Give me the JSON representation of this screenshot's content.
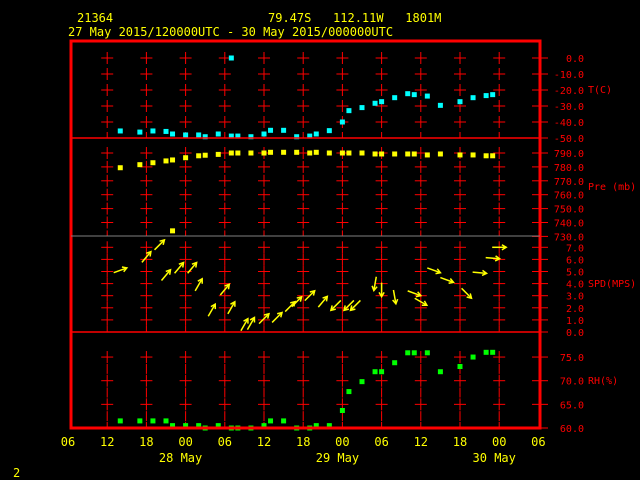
{
  "header": {
    "station": "21364",
    "location": "79.47S   112.11W   1801M",
    "period": "27 May 2015/120000UTC - 30 May 2015/000000UTC"
  },
  "footer": {
    "page_number": "2"
  },
  "colors": {
    "frame": "#ff0000",
    "separator_gray": "#808080",
    "temperature": "#00ffff",
    "pressure": "#ffff00",
    "wind": "#ffff00",
    "humidity": "#00ff00",
    "text": "#ffff00"
  },
  "chart_data": {
    "type": "scatter",
    "x_axis": {
      "tick_labels": [
        "06",
        "12",
        "18",
        "00",
        "06",
        "12",
        "18",
        "00",
        "06",
        "12",
        "18",
        "00",
        "06"
      ],
      "date_labels": [
        {
          "label": "28 May",
          "tick": 3
        },
        {
          "label": "29 May",
          "tick": 7
        },
        {
          "label": "30 May",
          "tick": 11
        }
      ],
      "range": [
        "2015-05-27 06:00",
        "2015-05-30 06:00"
      ]
    },
    "times": [
      "27 14",
      "27 17",
      "27 19",
      "27 21",
      "27 22",
      "28 00",
      "28 02",
      "28 03",
      "28 05",
      "28 07",
      "28 08",
      "28 10",
      "28 12",
      "28 13",
      "28 15",
      "28 17",
      "28 19",
      "28 20",
      "28 22",
      "29 00",
      "29 01",
      "29 03",
      "29 05",
      "29 06",
      "29 08",
      "29 10",
      "29 11",
      "29 13",
      "29 15",
      "29 18",
      "29 20",
      "29 22",
      "29 23"
    ],
    "panels": [
      {
        "key": "temperature",
        "title": "T(C)",
        "ticks": [
          0,
          -10,
          -20,
          -30,
          -40,
          -50
        ],
        "tick_labels": [
          "0.0",
          "-10.0",
          "-20.0",
          "-30.0",
          "-40.0",
          "-50.0"
        ],
        "ylim": [
          -50,
          0
        ],
        "values": [
          -45.6,
          -46.3,
          -45.6,
          -45.9,
          -47.5,
          -48.1,
          -48.1,
          -49.2,
          -47.5,
          -48.8,
          -48.8,
          -49.2,
          -47.5,
          -45.2,
          -45.2,
          -49.2,
          -48.8,
          -47.5,
          -45.4,
          -40.0,
          -32.9,
          -31.0,
          -28.3,
          -27.3,
          -24.8,
          -22.3,
          -22.9,
          -23.8,
          -29.6,
          -27.3,
          -24.8,
          -23.5,
          -22.9
        ],
        "extra_points": [
          {
            "time": "28 07",
            "value": 0.0
          }
        ]
      },
      {
        "key": "pressure",
        "title": "Pre (mb)",
        "ticks": [
          790,
          780,
          770,
          760,
          750,
          740,
          730
        ],
        "tick_labels": [
          "790.0",
          "780.0",
          "770.0",
          "760.0",
          "750.0",
          "740.0",
          "730.0"
        ],
        "ylim": [
          730,
          790
        ],
        "values": [
          779.4,
          781.6,
          783.0,
          784.3,
          785.0,
          786.6,
          788.0,
          788.4,
          789.0,
          790.0,
          790.0,
          790.0,
          790.0,
          790.5,
          790.5,
          790.5,
          790.0,
          790.5,
          790.0,
          790.0,
          790.0,
          790.0,
          789.3,
          789.3,
          789.3,
          789.3,
          789.3,
          788.6,
          789.3,
          788.6,
          788.6,
          788.0,
          788.0
        ],
        "extra_points": [
          {
            "time": "27 22",
            "value": 734.0
          }
        ]
      },
      {
        "key": "wind",
        "title": "SPD(MPS)",
        "ticks": [
          7,
          6,
          5,
          4,
          3,
          2,
          1,
          0
        ],
        "tick_labels": [
          "7.0",
          "6.0",
          "5.0",
          "4.0",
          "3.0",
          "2.0",
          "1.0",
          "0.0"
        ],
        "ylim": [
          0,
          7
        ],
        "arrows": [
          {
            "time": "27 14",
            "speed": 5.1,
            "toward_deg": 70
          },
          {
            "time": "27 18",
            "speed": 6.2,
            "toward_deg": 40
          },
          {
            "time": "27 20",
            "speed": 7.2,
            "toward_deg": 45
          },
          {
            "time": "27 21",
            "speed": 4.7,
            "toward_deg": 40
          },
          {
            "time": "27 23",
            "speed": 5.3,
            "toward_deg": 40
          },
          {
            "time": "28 01",
            "speed": 5.3,
            "toward_deg": 40
          },
          {
            "time": "28 02",
            "speed": 3.9,
            "toward_deg": 30
          },
          {
            "time": "28 04",
            "speed": 1.8,
            "toward_deg": 30
          },
          {
            "time": "28 06",
            "speed": 3.5,
            "toward_deg": 40
          },
          {
            "time": "28 07",
            "speed": 2.0,
            "toward_deg": 30
          },
          {
            "time": "28 09",
            "speed": 0.6,
            "toward_deg": 30
          },
          {
            "time": "28 10",
            "speed": 0.7,
            "toward_deg": 30
          },
          {
            "time": "28 12",
            "speed": 1.1,
            "toward_deg": 45
          },
          {
            "time": "28 14",
            "speed": 1.2,
            "toward_deg": 45
          },
          {
            "time": "28 16",
            "speed": 2.1,
            "toward_deg": 45
          },
          {
            "time": "28 17",
            "speed": 2.5,
            "toward_deg": 45
          },
          {
            "time": "28 19",
            "speed": 3.0,
            "toward_deg": 45
          },
          {
            "time": "28 21",
            "speed": 2.5,
            "toward_deg": 40
          },
          {
            "time": "28 23",
            "speed": 2.2,
            "toward_deg": 225
          },
          {
            "time": "29 01",
            "speed": 2.2,
            "toward_deg": 225
          },
          {
            "time": "29 02",
            "speed": 2.2,
            "toward_deg": 225
          },
          {
            "time": "29 05",
            "speed": 4.0,
            "toward_deg": 190
          },
          {
            "time": "29 06",
            "speed": 3.5,
            "toward_deg": 180
          },
          {
            "time": "29 08",
            "speed": 2.9,
            "toward_deg": 170
          },
          {
            "time": "29 11",
            "speed": 3.2,
            "toward_deg": 110
          },
          {
            "time": "29 12",
            "speed": 2.5,
            "toward_deg": 120
          },
          {
            "time": "29 14",
            "speed": 5.1,
            "toward_deg": 110
          },
          {
            "time": "29 16",
            "speed": 4.3,
            "toward_deg": 110
          },
          {
            "time": "29 19",
            "speed": 3.2,
            "toward_deg": 135
          },
          {
            "time": "29 21",
            "speed": 4.9,
            "toward_deg": 95
          },
          {
            "time": "29 23",
            "speed": 6.1,
            "toward_deg": 95
          },
          {
            "time": "30 00",
            "speed": 7.0,
            "toward_deg": 90
          }
        ]
      },
      {
        "key": "humidity",
        "title": "RH(%)",
        "ticks": [
          75,
          70,
          65,
          60
        ],
        "tick_labels": [
          "75.0",
          "70.0",
          "65.0",
          "60.0"
        ],
        "ylim": [
          60,
          77
        ],
        "values": [
          61.5,
          61.5,
          61.5,
          61.5,
          60.5,
          60.5,
          60.5,
          60.0,
          60.5,
          60.0,
          60.0,
          60.0,
          60.5,
          61.5,
          61.5,
          60.0,
          60.0,
          60.5,
          60.5,
          63.7,
          67.7,
          69.8,
          71.9,
          71.9,
          73.8,
          75.9,
          75.9,
          75.9,
          71.9,
          73.0,
          75.0,
          76.0,
          76.0
        ]
      }
    ]
  }
}
